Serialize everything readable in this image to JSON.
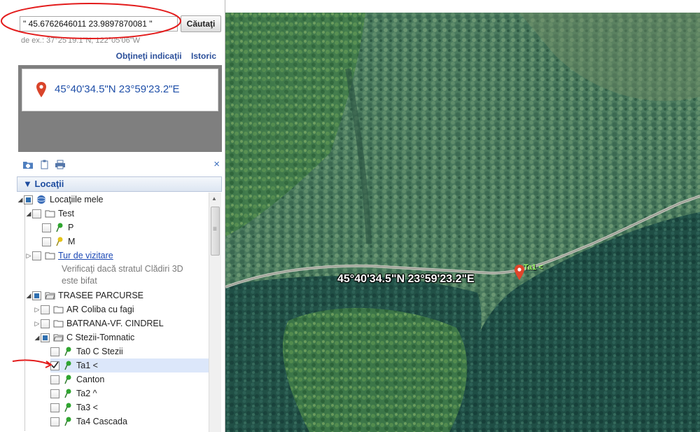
{
  "search": {
    "value": "\" 45.6762646011 23.9897870081 \"",
    "button": "Căutaţi",
    "hint": "de ex.: 37°25'19.1\"N, 122°05'06\"W"
  },
  "links": {
    "directions": "Obţineţi indicaţii",
    "history": "Istoric"
  },
  "result": {
    "coords": "45°40'34.5\"N 23°59'23.2\"E"
  },
  "toolbar": {
    "close": "×"
  },
  "places": {
    "header": "Locaţii",
    "items": [
      {
        "label": "Locaţiile mele"
      },
      {
        "label": "Test"
      },
      {
        "label": "P"
      },
      {
        "label": "M"
      },
      {
        "label": "Tur de vizitare",
        "note_1": "Verificaţi dacă stratul Clădiri 3D",
        "note_2": "este bifat"
      },
      {
        "label": "TRASEE PARCURSE"
      },
      {
        "label": "AR Coliba cu fagi"
      },
      {
        "label": "BATRANA-VF. CINDREL"
      },
      {
        "label": "C Stezii-Tomnatic"
      },
      {
        "label": "Ta0 C Stezii"
      },
      {
        "label": "Ta1 <"
      },
      {
        "label": "Canton"
      },
      {
        "label": "Ta2 ^"
      },
      {
        "label": "Ta3 <"
      },
      {
        "label": "Ta4 Cascada"
      }
    ]
  },
  "map": {
    "label": "45°40'34.5\"N 23°59'23.2\"E",
    "pin_label": "Ta1 <"
  },
  "colors": {
    "accent": "#1e4da0",
    "pin": "#e0452b",
    "annotation": "#e31c1c"
  }
}
